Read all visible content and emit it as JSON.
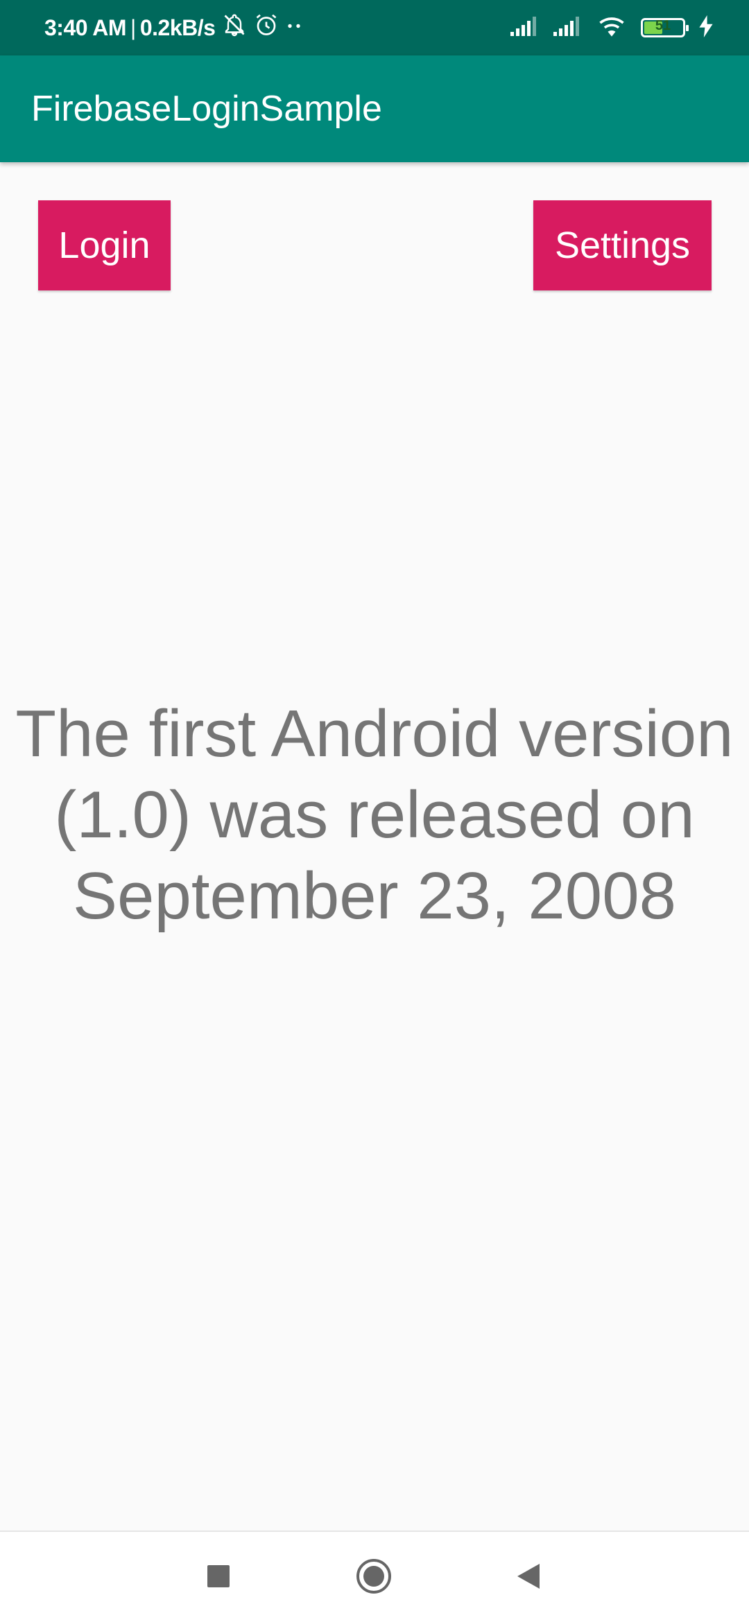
{
  "status_bar": {
    "time": "3:40 AM",
    "separator": "|",
    "network_speed": "0.2kB/s",
    "icons": [
      "notifications-off-icon",
      "alarm-icon",
      "more-dots-icon",
      "signal-icon",
      "signal-icon",
      "wifi-icon",
      "battery-icon",
      "charging-icon"
    ],
    "battery_level": "51",
    "battery_fraction": 0.51,
    "battery_color": "#7cd44c",
    "background_color": "#00695c"
  },
  "app_bar": {
    "title": "FirebaseLoginSample",
    "background_color": "#00897b"
  },
  "buttons": {
    "login_label": "Login",
    "settings_label": "Settings",
    "color": "#d81b60"
  },
  "content": {
    "fact_text": "The first Android version (1.0) was released on September 23, 2008",
    "text_color": "#757575"
  },
  "nav_bar": {
    "icons": [
      "recents-icon",
      "home-icon",
      "back-icon"
    ]
  }
}
